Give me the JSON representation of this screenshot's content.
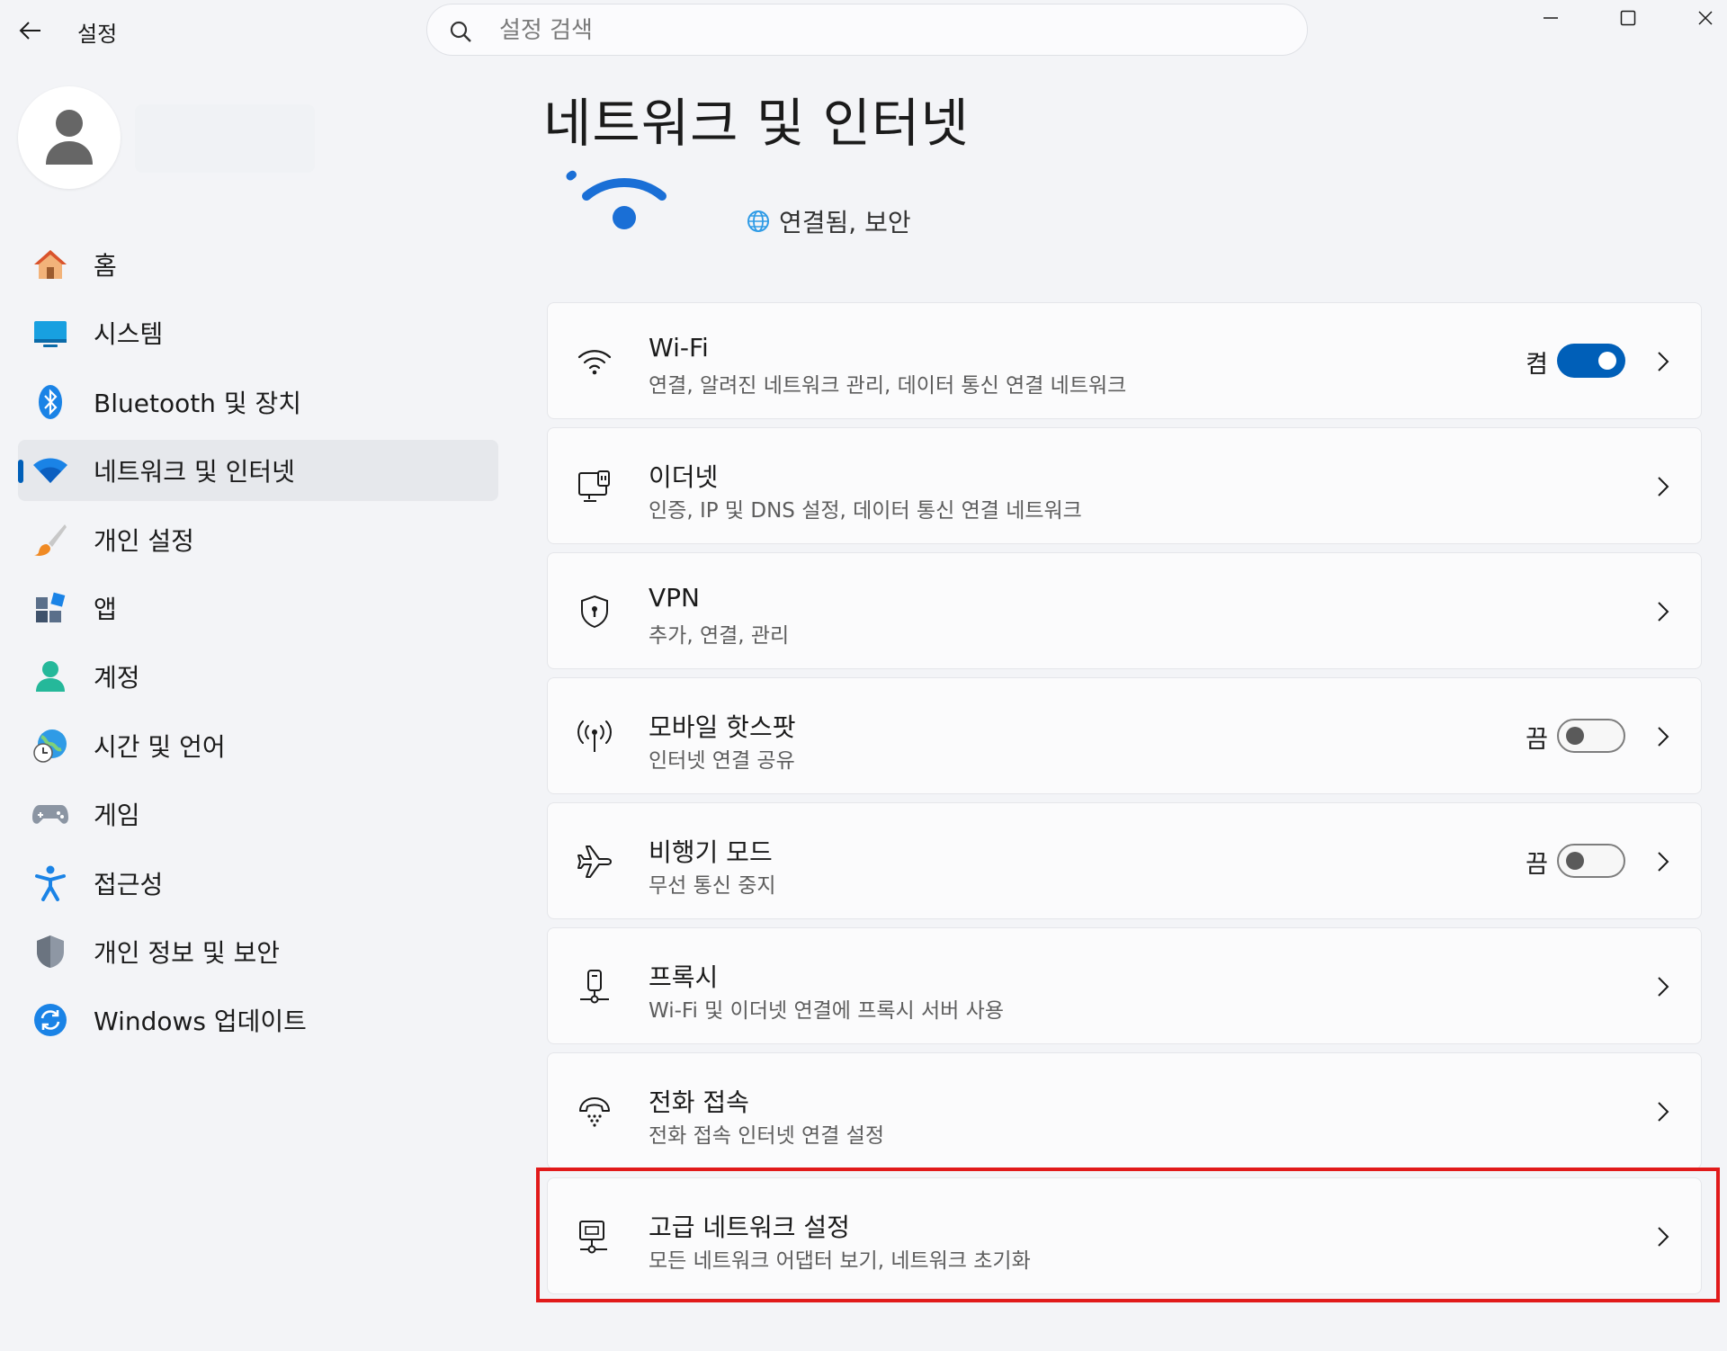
{
  "window": {
    "app_title": "설정",
    "search_placeholder": "설정 검색"
  },
  "sidebar": {
    "items": [
      {
        "label": "홈",
        "icon": "home-icon"
      },
      {
        "label": "시스템",
        "icon": "system-icon"
      },
      {
        "label": "Bluetooth 및 장치",
        "icon": "bluetooth-icon"
      },
      {
        "label": "네트워크 및 인터넷",
        "icon": "network-icon",
        "active": true
      },
      {
        "label": "개인 설정",
        "icon": "brush-icon"
      },
      {
        "label": "앱",
        "icon": "apps-icon"
      },
      {
        "label": "계정",
        "icon": "account-icon"
      },
      {
        "label": "시간 및 언어",
        "icon": "time-language-icon"
      },
      {
        "label": "게임",
        "icon": "gamepad-icon"
      },
      {
        "label": "접근성",
        "icon": "accessibility-icon"
      },
      {
        "label": "개인 정보 및 보안",
        "icon": "shield-icon"
      },
      {
        "label": "Windows 업데이트",
        "icon": "update-icon"
      }
    ]
  },
  "main": {
    "title": "네트워크 및 인터넷",
    "status": "연결됨, 보안",
    "cards": [
      {
        "title": "Wi-Fi",
        "subtitle": "연결, 알려진 네트워크 관리, 데이터 통신 연결 네트워크",
        "icon": "wifi-icon",
        "state": "켬",
        "toggle": "on"
      },
      {
        "title": "이더넷",
        "subtitle": "인증, IP 및 DNS 설정, 데이터 통신 연결 네트워크",
        "icon": "ethernet-icon"
      },
      {
        "title": "VPN",
        "subtitle": "추가, 연결, 관리",
        "icon": "vpn-shield-icon"
      },
      {
        "title": "모바일 핫스팟",
        "subtitle": "인터넷 연결 공유",
        "icon": "hotspot-icon",
        "state": "끔",
        "toggle": "off"
      },
      {
        "title": "비행기 모드",
        "subtitle": "무선 통신 중지",
        "icon": "airplane-icon",
        "state": "끔",
        "toggle": "off"
      },
      {
        "title": "프록시",
        "subtitle": "Wi-Fi 및 이더넷 연결에 프록시 서버 사용",
        "icon": "proxy-icon"
      },
      {
        "title": "전화 접속",
        "subtitle": "전화 접속 인터넷 연결 설정",
        "icon": "dialup-icon"
      },
      {
        "title": "고급 네트워크 설정",
        "subtitle": "모든 네트워크 어댑터 보기, 네트워크 초기화",
        "icon": "advanced-network-icon"
      }
    ]
  },
  "colors": {
    "accent": "#005fb8",
    "highlight_border": "#e11a1a",
    "background": "#f3f4f7"
  }
}
